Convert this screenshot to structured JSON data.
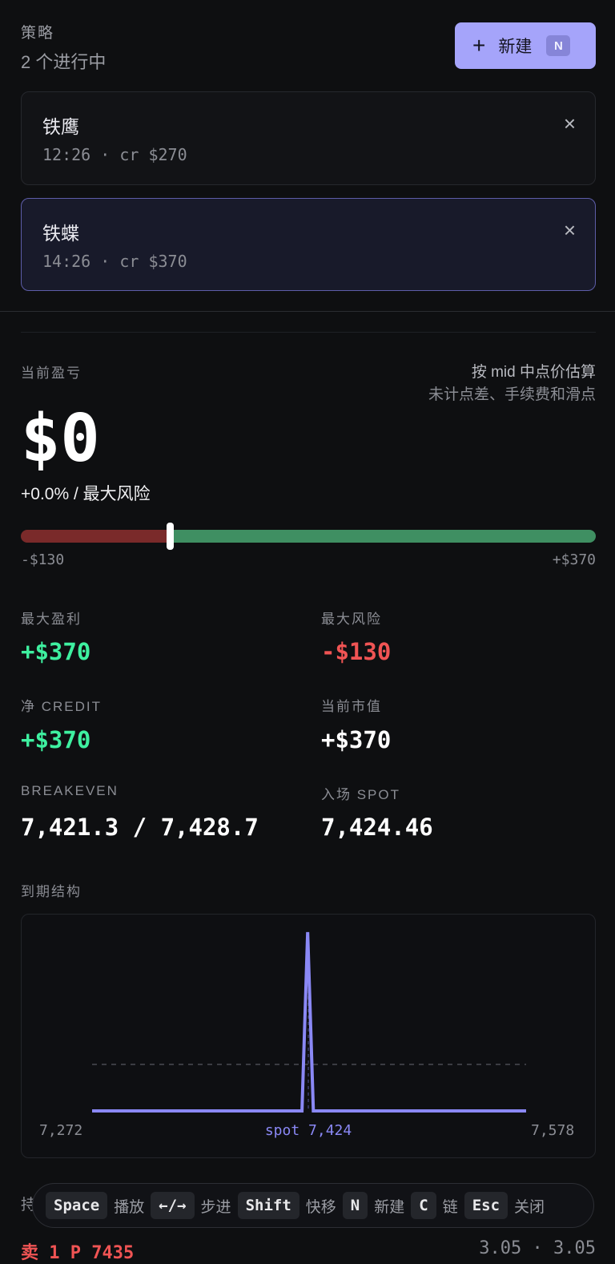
{
  "header": {
    "title": "策略",
    "subtitle": "2 个进行中",
    "new_label": "新建",
    "new_key": "N"
  },
  "strategies": [
    {
      "name": "铁鹰",
      "meta": "12:26 · cr $270",
      "active": false
    },
    {
      "name": "铁蝶",
      "meta": "14:26 · cr $370",
      "active": true
    }
  ],
  "pnl": {
    "label": "当前盈亏",
    "note_line1": "按 mid 中点价估算",
    "note_line2": "未计点差、手续费和滑点",
    "value": "$0",
    "sub": "+0.0% / 最大风险",
    "range_min": "-$130",
    "range_max": "+$370",
    "position_fraction": 0.26
  },
  "stats": {
    "max_profit_label": "最大盈利",
    "max_profit": "+$370",
    "max_risk_label": "最大风险",
    "max_risk": "-$130",
    "net_credit_label": "净 CREDIT",
    "net_credit": "+$370",
    "market_value_label": "当前市值",
    "market_value": "+$370",
    "breakeven_label": "BREAKEVEN",
    "breakeven": "7,421.3 / 7,428.7",
    "entry_spot_label": "入场 SPOT",
    "entry_spot": "7,424.46"
  },
  "chart_data": {
    "type": "line",
    "title": "到期结构",
    "x": [
      7272,
      7420,
      7424,
      7428,
      7578
    ],
    "y": [
      0,
      0,
      1,
      0,
      0
    ],
    "xmin_label": "7,272",
    "xmax_label": "7,578",
    "spot_label": "spot 7,424",
    "spot": 7424.46,
    "colors": {
      "line": "#8a88f5",
      "zero": "#4a4c52"
    }
  },
  "shortcuts": [
    {
      "key": "Space",
      "label": "播放"
    },
    {
      "key": "←/→",
      "label": "步进"
    },
    {
      "key": "Shift",
      "label": "快移"
    },
    {
      "key": "N",
      "label": "新建"
    },
    {
      "key": "C",
      "label": "链"
    },
    {
      "key": "Esc",
      "label": "关闭"
    }
  ],
  "positions": {
    "behind_label": "持仓 · 1× 铁",
    "first_leg": "卖 1 P 7435",
    "first_leg_price": "3.05 · 3.05"
  }
}
